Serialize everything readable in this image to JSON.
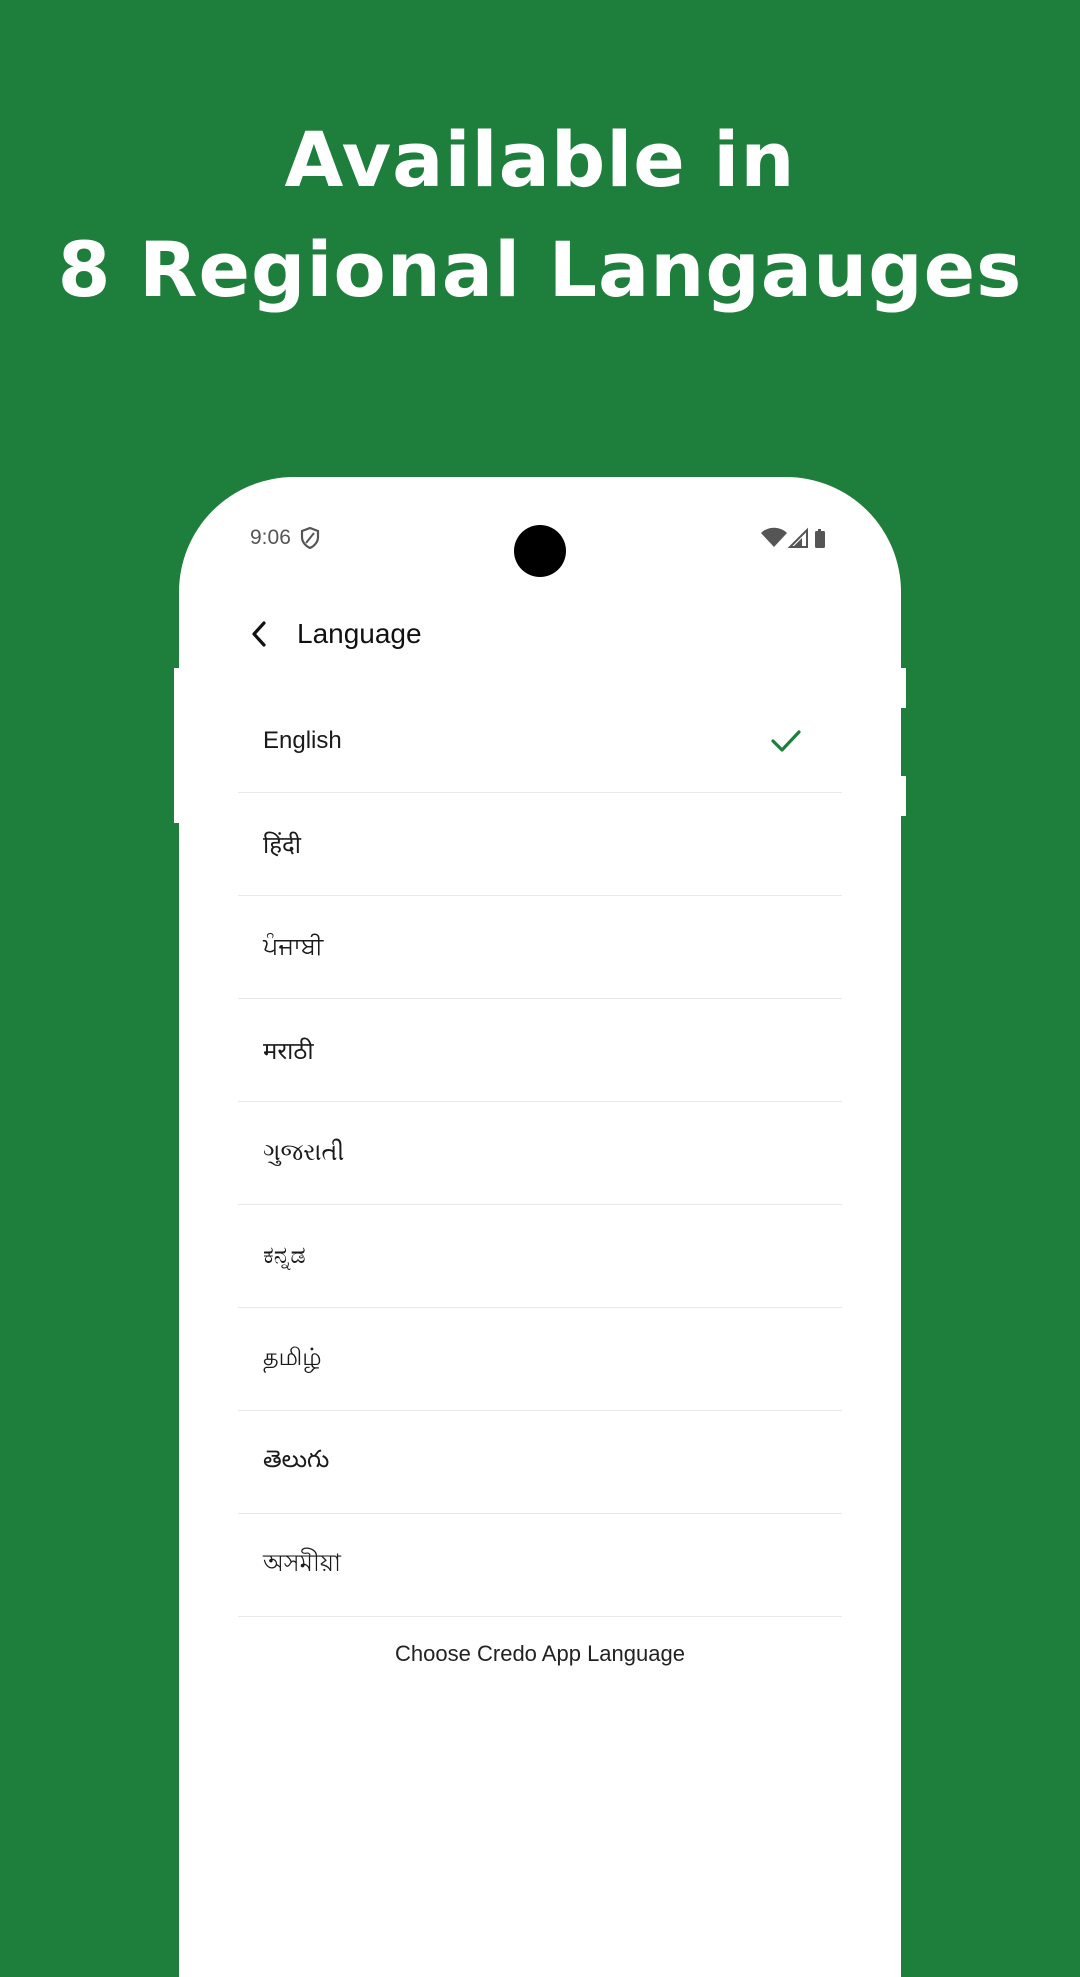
{
  "colors": {
    "background": "#1e7f3d",
    "accent_check": "#1e7f3d",
    "phone_surface": "#ffffff"
  },
  "headline": {
    "line1": "Available in",
    "line2": "8 Regional Langauges"
  },
  "status_bar": {
    "time": "9:06",
    "icons": [
      "shield-icon",
      "wifi-icon",
      "signal-icon",
      "battery-icon"
    ]
  },
  "appbar": {
    "back_icon": "chevron-left-icon",
    "title": "Language"
  },
  "languages": [
    {
      "label": "English",
      "selected": true
    },
    {
      "label": "हिंदी",
      "selected": false
    },
    {
      "label": "ਪੰਜਾਬੀ",
      "selected": false
    },
    {
      "label": "मराठी",
      "selected": false
    },
    {
      "label": "ગુજરાતી",
      "selected": false
    },
    {
      "label": "ಕನ್ನಡ",
      "selected": false
    },
    {
      "label": "தமிழ்",
      "selected": false
    },
    {
      "label": "తెలుగు",
      "selected": false
    },
    {
      "label": "অসমীয়া",
      "selected": false
    }
  ],
  "footer": {
    "text": "Choose Credo App Language"
  }
}
